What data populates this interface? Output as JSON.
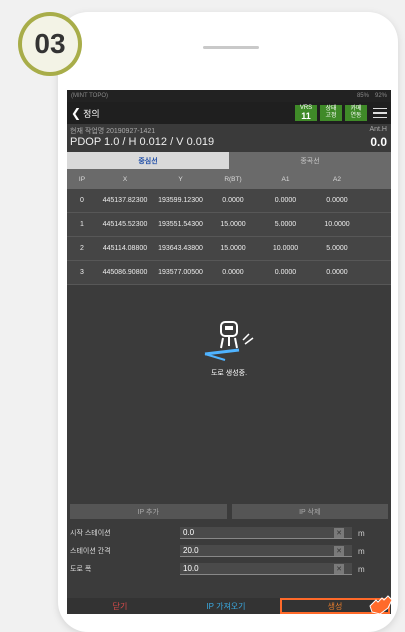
{
  "step_number": "03",
  "status_bar": {
    "left": "(MINT TOPO)",
    "battery1": "85%",
    "battery2": "92%"
  },
  "title_bar": {
    "back_label": "정의",
    "chips": [
      {
        "top": "VRS",
        "bottom": "11"
      },
      {
        "top": "상태",
        "bottom": "고정"
      },
      {
        "top": "카메",
        "bottom": "연동"
      }
    ]
  },
  "info": {
    "job_name": "현재 작업명 20190927-1421",
    "dop": "PDOP 1.0 / H 0.012 / V 0.019",
    "ant_label": "Ant.H",
    "ant_value": "0.0"
  },
  "tabs": [
    {
      "label": "중심선"
    },
    {
      "label": "종곡선"
    }
  ],
  "table": {
    "headers": [
      "IP",
      "X",
      "Y",
      "R(BT)",
      "A1",
      "A2"
    ],
    "rows": [
      [
        "0",
        "445137.82300",
        "193599.12300",
        "0.0000",
        "0.0000",
        "0.0000"
      ],
      [
        "1",
        "445145.52300",
        "193551.54300",
        "15.0000",
        "5.0000",
        "10.0000"
      ],
      [
        "2",
        "445114.08800",
        "193643.43800",
        "15.0000",
        "10.0000",
        "5.0000"
      ],
      [
        "3",
        "445086.90800",
        "193577.00500",
        "0.0000",
        "0.0000",
        "0.0000"
      ]
    ]
  },
  "loading_text": "도로 생성중.",
  "ip_buttons": {
    "add": "IP 추가",
    "delete": "IP 삭제"
  },
  "fields": [
    {
      "label": "시작 스테이션",
      "value": "0.0",
      "unit": "m"
    },
    {
      "label": "스테이션 간격",
      "value": "20.0",
      "unit": "m"
    },
    {
      "label": "도로 폭",
      "value": "10.0",
      "unit": "m"
    }
  ],
  "bottom_buttons": {
    "close": "닫기",
    "import": "IP 가져오기",
    "create": "생성"
  },
  "colors": {
    "badge": "#a8ad49",
    "chip_green": "#3f8a28",
    "active_tab_text": "#1f4ea8",
    "create_highlight": "#ff6a2a"
  }
}
